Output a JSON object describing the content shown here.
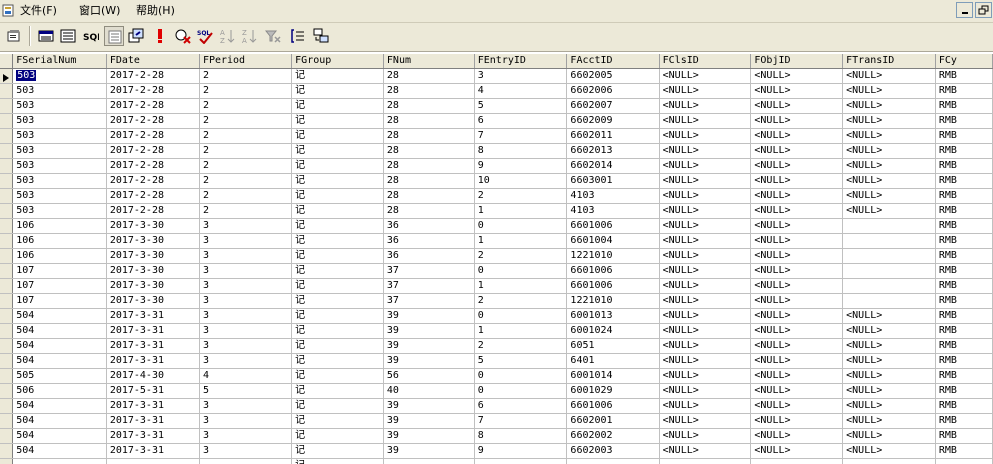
{
  "menu": {
    "file": "文件(F)",
    "window": "窗口(W)",
    "help": "帮助(H)"
  },
  "icons": {
    "app": "app-icon",
    "minimize": "minimize-icon",
    "restore": "restore-icon",
    "toolbar": [
      "properties-icon",
      "grid-view-icon",
      "form-view-icon",
      "sql-icon",
      "text-view-icon",
      "export-icon",
      "run-icon",
      "check-syntax-icon",
      "sort-asc-icon",
      "sort-desc-icon",
      "remove-filter-icon",
      "filter-icon",
      "new-row-icon"
    ]
  },
  "toolbar_labels": {
    "sql": "SQL",
    "check_sql": "SQL"
  },
  "grid": {
    "columns": [
      "FSerialNum",
      "FDate",
      "FPeriod",
      "FGroup",
      "FNum",
      "FEntryID",
      "FAcctID",
      "FClsID",
      "FObjID",
      "FTransID",
      "FCy"
    ],
    "rows": [
      [
        "503",
        "2017-2-28",
        "2",
        "记",
        "28",
        "3",
        "6602005",
        "<NULL>",
        "<NULL>",
        "<NULL>",
        "RMB"
      ],
      [
        "503",
        "2017-2-28",
        "2",
        "记",
        "28",
        "4",
        "6602006",
        "<NULL>",
        "<NULL>",
        "<NULL>",
        "RMB"
      ],
      [
        "503",
        "2017-2-28",
        "2",
        "记",
        "28",
        "5",
        "6602007",
        "<NULL>",
        "<NULL>",
        "<NULL>",
        "RMB"
      ],
      [
        "503",
        "2017-2-28",
        "2",
        "记",
        "28",
        "6",
        "6602009",
        "<NULL>",
        "<NULL>",
        "<NULL>",
        "RMB"
      ],
      [
        "503",
        "2017-2-28",
        "2",
        "记",
        "28",
        "7",
        "6602011",
        "<NULL>",
        "<NULL>",
        "<NULL>",
        "RMB"
      ],
      [
        "503",
        "2017-2-28",
        "2",
        "记",
        "28",
        "8",
        "6602013",
        "<NULL>",
        "<NULL>",
        "<NULL>",
        "RMB"
      ],
      [
        "503",
        "2017-2-28",
        "2",
        "记",
        "28",
        "9",
        "6602014",
        "<NULL>",
        "<NULL>",
        "<NULL>",
        "RMB"
      ],
      [
        "503",
        "2017-2-28",
        "2",
        "记",
        "28",
        "10",
        "6603001",
        "<NULL>",
        "<NULL>",
        "<NULL>",
        "RMB"
      ],
      [
        "503",
        "2017-2-28",
        "2",
        "记",
        "28",
        "2",
        "4103",
        "<NULL>",
        "<NULL>",
        "<NULL>",
        "RMB"
      ],
      [
        "503",
        "2017-2-28",
        "2",
        "记",
        "28",
        "1",
        "4103",
        "<NULL>",
        "<NULL>",
        "<NULL>",
        "RMB"
      ],
      [
        "106",
        "2017-3-30",
        "3",
        "记",
        "36",
        "0",
        "6601006",
        "<NULL>",
        "<NULL>",
        "",
        "RMB"
      ],
      [
        "106",
        "2017-3-30",
        "3",
        "记",
        "36",
        "1",
        "6601004",
        "<NULL>",
        "<NULL>",
        "",
        "RMB"
      ],
      [
        "106",
        "2017-3-30",
        "3",
        "记",
        "36",
        "2",
        "1221010",
        "<NULL>",
        "<NULL>",
        "",
        "RMB"
      ],
      [
        "107",
        "2017-3-30",
        "3",
        "记",
        "37",
        "0",
        "6601006",
        "<NULL>",
        "<NULL>",
        "",
        "RMB"
      ],
      [
        "107",
        "2017-3-30",
        "3",
        "记",
        "37",
        "1",
        "6601006",
        "<NULL>",
        "<NULL>",
        "",
        "RMB"
      ],
      [
        "107",
        "2017-3-30",
        "3",
        "记",
        "37",
        "2",
        "1221010",
        "<NULL>",
        "<NULL>",
        "",
        "RMB"
      ],
      [
        "504",
        "2017-3-31",
        "3",
        "记",
        "39",
        "0",
        "6001013",
        "<NULL>",
        "<NULL>",
        "<NULL>",
        "RMB"
      ],
      [
        "504",
        "2017-3-31",
        "3",
        "记",
        "39",
        "1",
        "6001024",
        "<NULL>",
        "<NULL>",
        "<NULL>",
        "RMB"
      ],
      [
        "504",
        "2017-3-31",
        "3",
        "记",
        "39",
        "2",
        "6051",
        "<NULL>",
        "<NULL>",
        "<NULL>",
        "RMB"
      ],
      [
        "504",
        "2017-3-31",
        "3",
        "记",
        "39",
        "5",
        "6401",
        "<NULL>",
        "<NULL>",
        "<NULL>",
        "RMB"
      ],
      [
        "505",
        "2017-4-30",
        "4",
        "记",
        "56",
        "0",
        "6001014",
        "<NULL>",
        "<NULL>",
        "<NULL>",
        "RMB"
      ],
      [
        "506",
        "2017-5-31",
        "5",
        "记",
        "40",
        "0",
        "6001029",
        "<NULL>",
        "<NULL>",
        "<NULL>",
        "RMB"
      ],
      [
        "504",
        "2017-3-31",
        "3",
        "记",
        "39",
        "6",
        "6601006",
        "<NULL>",
        "<NULL>",
        "<NULL>",
        "RMB"
      ],
      [
        "504",
        "2017-3-31",
        "3",
        "记",
        "39",
        "7",
        "6602001",
        "<NULL>",
        "<NULL>",
        "<NULL>",
        "RMB"
      ],
      [
        "504",
        "2017-3-31",
        "3",
        "记",
        "39",
        "8",
        "6602002",
        "<NULL>",
        "<NULL>",
        "<NULL>",
        "RMB"
      ],
      [
        "504",
        "2017-3-31",
        "3",
        "记",
        "39",
        "9",
        "6602003",
        "<NULL>",
        "<NULL>",
        "<NULL>",
        "RMB"
      ],
      [
        "",
        "",
        "",
        "记",
        "",
        "",
        "",
        "",
        "",
        "",
        ""
      ]
    ],
    "current_row": 0
  }
}
